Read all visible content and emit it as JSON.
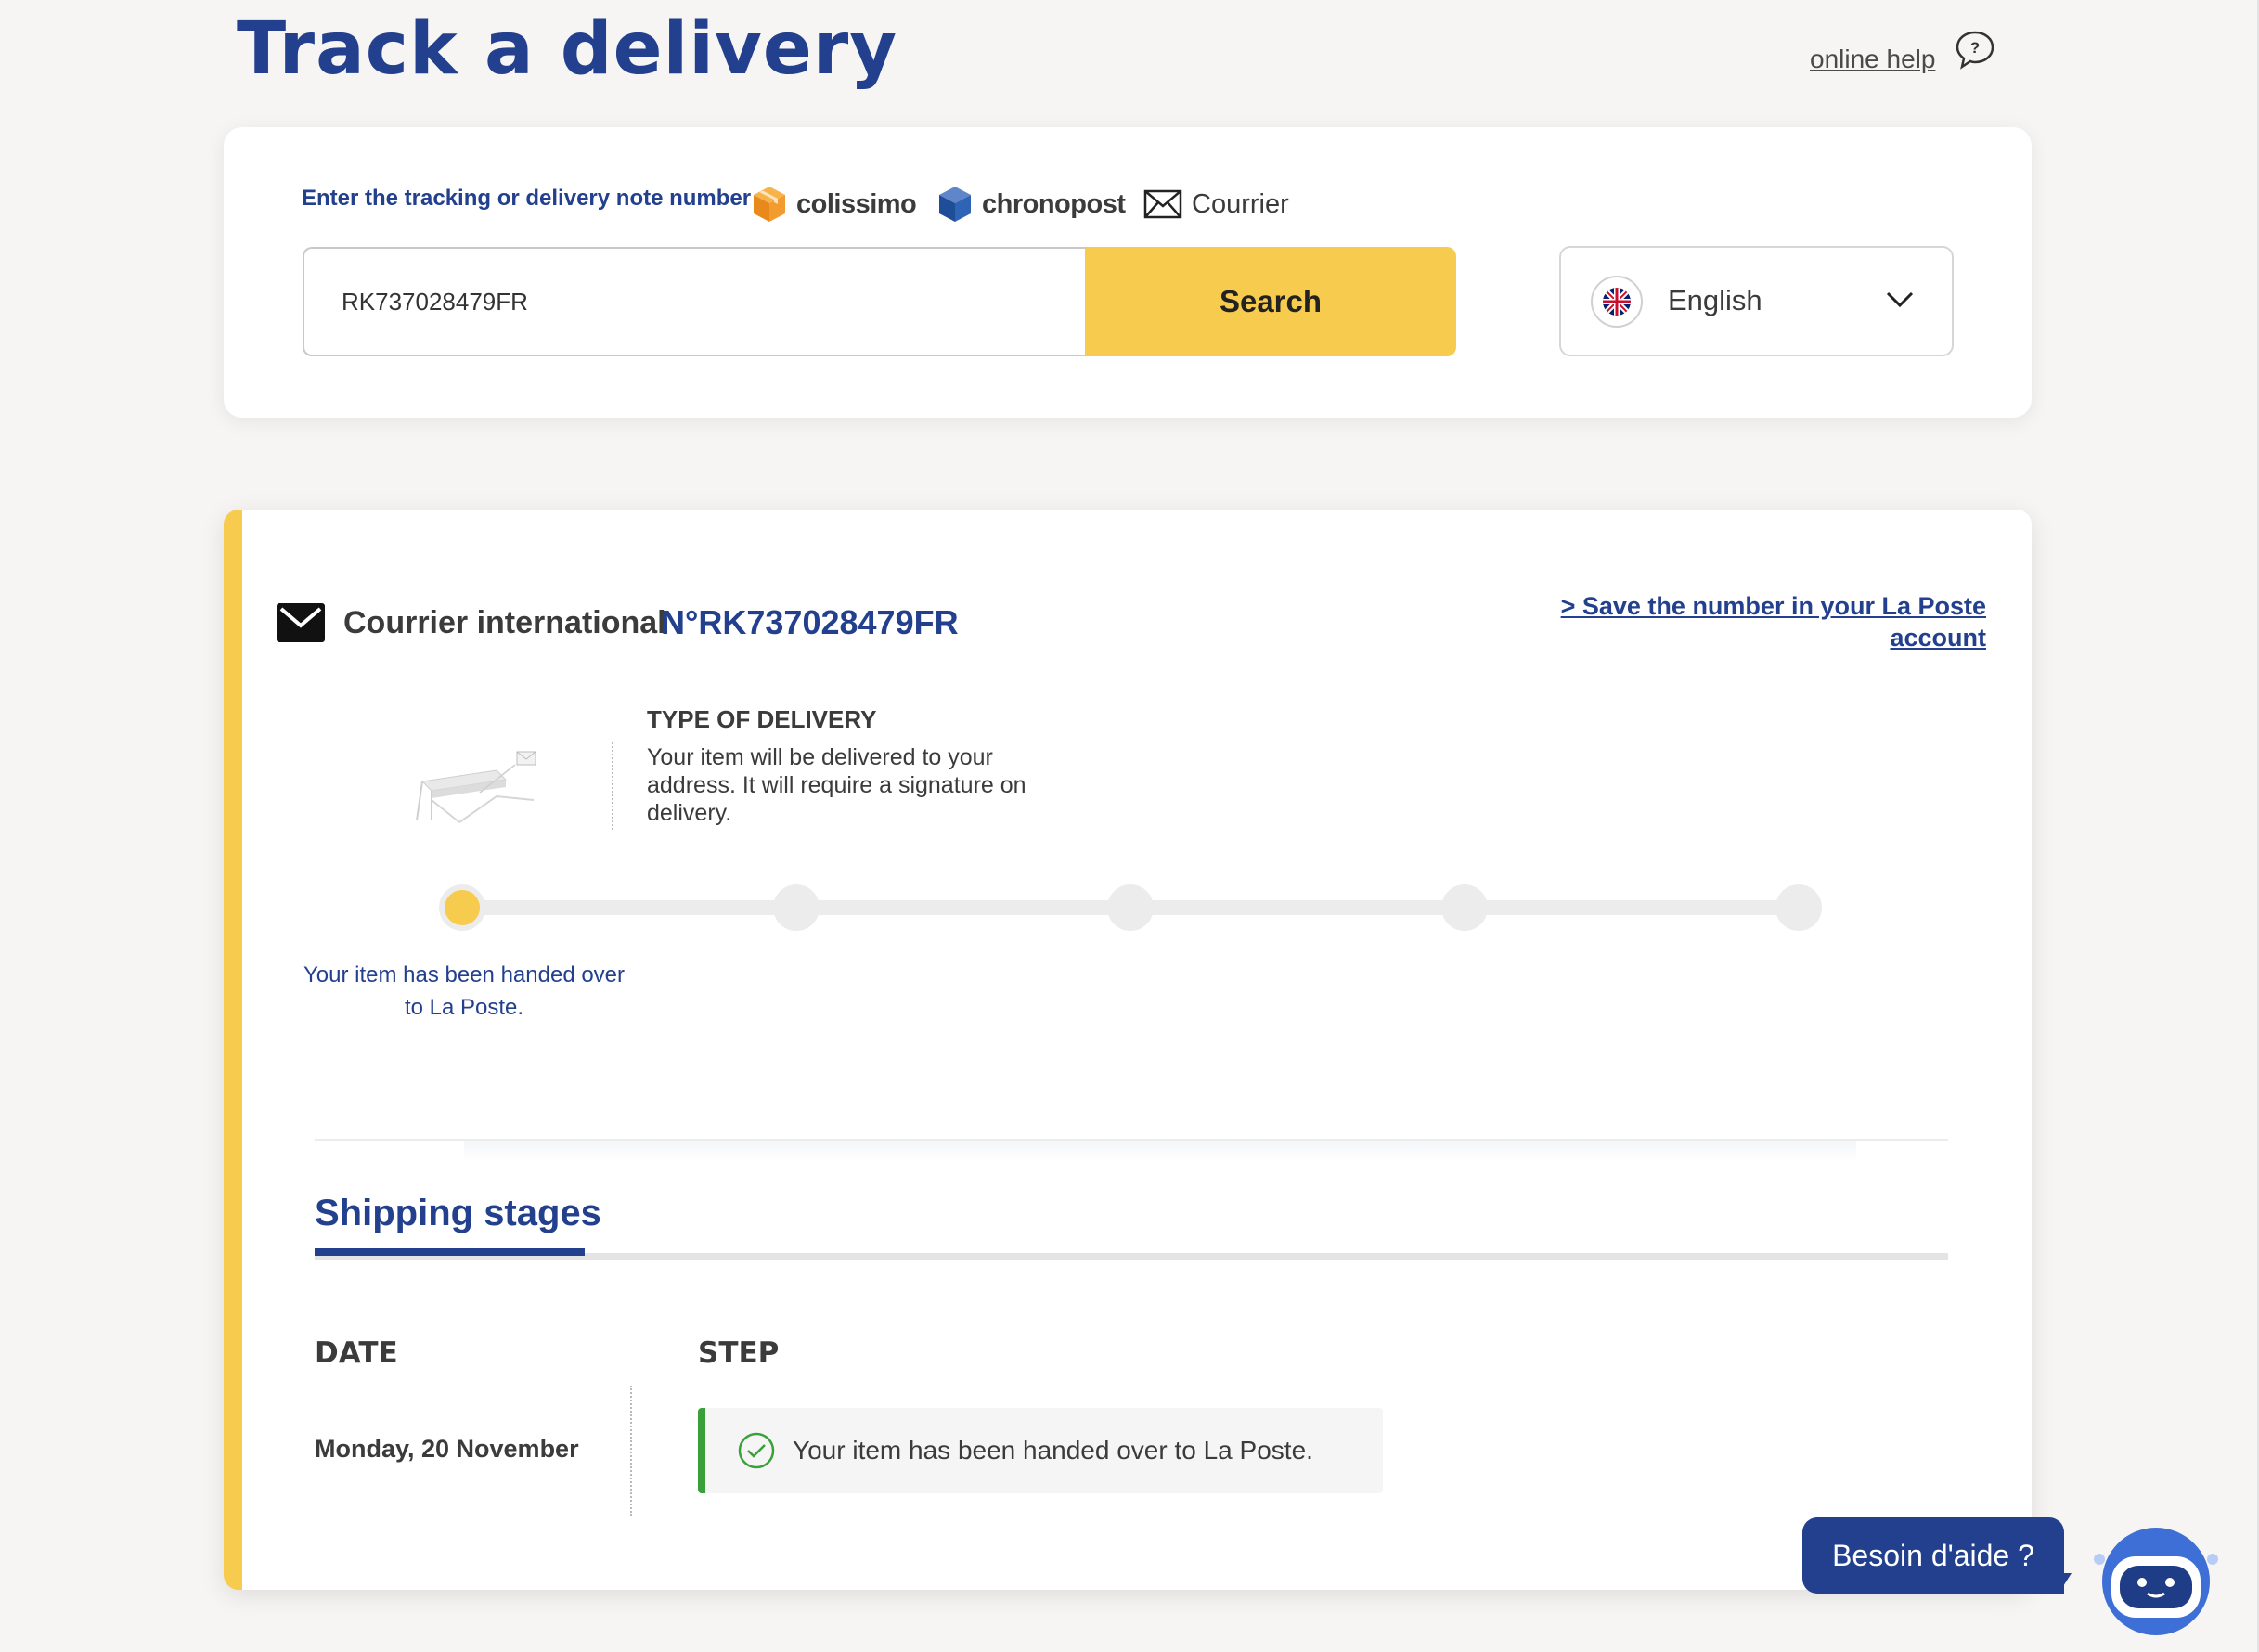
{
  "header": {
    "title": "Track a delivery",
    "help_link": "online help",
    "help_icon": "chat-question-icon"
  },
  "search": {
    "label": "Enter the tracking or delivery note number",
    "carriers": [
      {
        "name": "colissimo",
        "icon": "box-orange-icon"
      },
      {
        "name": "chronopost",
        "icon": "box-blue-icon"
      },
      {
        "name": "Courrier",
        "icon": "envelope-icon"
      }
    ],
    "input_value": "RK737028479FR",
    "button_label": "Search",
    "language": "English",
    "language_icon": "uk-flag-icon"
  },
  "shipment": {
    "type_label": "Courrier international",
    "number": "N°RK737028479FR",
    "save_link": "> Save the number in your La Poste account",
    "delivery_type_title": "TYPE OF DELIVERY",
    "delivery_type_desc": "Your item will be delivered to your address. It will require a signature on delivery.",
    "timeline": {
      "steps_total": 5,
      "current_step": 1,
      "current_caption": "Your item has been handed over to La Poste."
    }
  },
  "stages": {
    "title": "Shipping stages",
    "col_date": "DATE",
    "col_step": "STEP",
    "rows": [
      {
        "date": "Monday, 20 November",
        "step": "Your item has been handed over to La Poste.",
        "status": "done"
      }
    ]
  },
  "chat": {
    "label": "Besoin d'aide ?",
    "bot_icon": "chatbot-icon"
  },
  "colors": {
    "brand_blue": "#23408e",
    "accent_yellow": "#f7cb4d",
    "success_green": "#3aa03a",
    "background": "#f6f5f3"
  }
}
